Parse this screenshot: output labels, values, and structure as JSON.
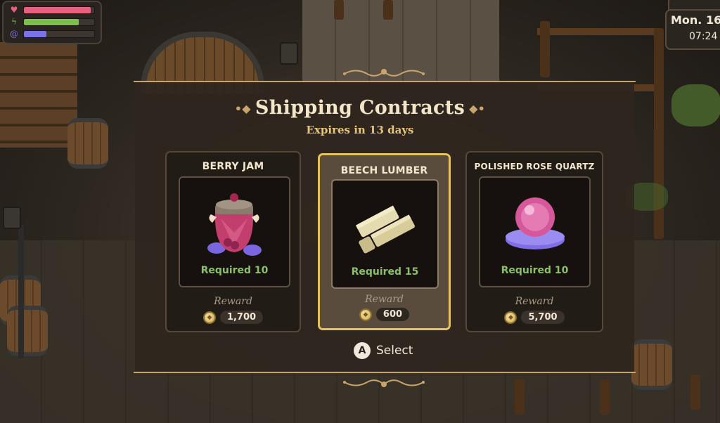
{
  "hud": {
    "health": 0.95,
    "stamina": 0.78,
    "magic": 0.32,
    "colors": {
      "health": "#e8607f",
      "stamina": "#7cc04b",
      "magic": "#7a74e8"
    },
    "icons": [
      "heart-icon",
      "lightning-icon",
      "swirl-icon"
    ],
    "day": "Mon. 16",
    "time": "07:24"
  },
  "dialog": {
    "title": "Shipping Contracts",
    "expires": "Expires in 13 days",
    "contracts": [
      {
        "name": "BERRY JAM",
        "required": "Required 10",
        "reward_label": "Reward",
        "reward": "1,700",
        "icon": "berry-jam-jar-icon",
        "selected": false
      },
      {
        "name": "BEECH LUMBER",
        "required": "Required 15",
        "reward_label": "Reward",
        "reward": "600",
        "icon": "lumber-planks-icon",
        "selected": true
      },
      {
        "name": "POLISHED ROSE QUARTZ",
        "required": "Required 10",
        "reward_label": "Reward",
        "reward": "5,700",
        "icon": "rose-quartz-orb-icon",
        "selected": false
      }
    ],
    "prompt": {
      "button": "A",
      "label": "Select"
    }
  },
  "colors": {
    "accent": "#e6c15f",
    "required": "#8cc066",
    "expires": "#e7c57a"
  }
}
